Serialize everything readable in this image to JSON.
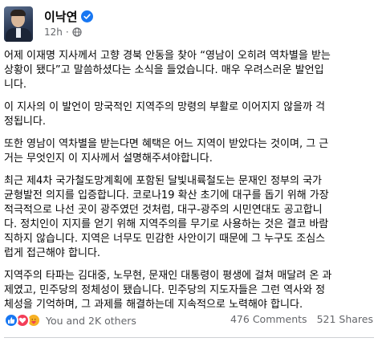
{
  "author": {
    "name": "이낙연",
    "verified": true,
    "timestamp": "12h",
    "audience_icon": "globe-icon"
  },
  "post": {
    "paragraphs": [
      "어제 이재명 지사께서 고향 경북 안동을 찾아 “영남이 오히려 역차별을 받는\n상황이 됐다”고 말씀하셨다는 소식을 들었습니다. 매우 우려스러운 발언입\n니다.",
      "이 지사의 이 발언이 망국적인 지역주의 망령의 부활로 이어지지 않을까 걱\n정됩니다.",
      "또한 영남이 역차별을 받는다면 혜택은 어느 지역이 받았다는 것이며, 그 근\n거는 무엇인지 이 지사께서 설명해주셔야합니다.",
      "최근 제4차 국가철도망계획에 포함된 달빛내륙철도는 문재인 정부의 국가\n균형발전 의지를 입증합니다. 코로나19 확산 초기에 대구를 돕기 위해 가장\n적극적으로 나선 곳이 광주였던 것처럼, 대구-광주의 시민연대도 공고합니\n다. 정치인이 지지를 얻기 위해 지역주의를 무기로 사용하는 것은 결코 바람\n직하지 않습니다. 지역은 너무도 민감한 사안이기 때문에 그 누구도 조심스\n럽게 접근해야 합니다.",
      "지역주의 타파는 김대중, 노무현, 문재인 대통령이 평생에 걸쳐 매달려 온 과\n제였고, 민주당의 정체성이 됐습니다. 민주당의 지도자들은 그런 역사와 정\n체성을 기억하며, 그 과제를 해결하는데 지속적으로 노력해야 합니다."
    ]
  },
  "reactions": {
    "summary": "You and 2K others",
    "icons": [
      "like-icon",
      "love-icon",
      "care-icon"
    ]
  },
  "stats": {
    "comments": "476 Comments",
    "shares": "521 Shares"
  },
  "colors": {
    "like": "#1877f2",
    "love": "#f33e58",
    "care": "#f7b125",
    "muted_text": "#65676b"
  }
}
